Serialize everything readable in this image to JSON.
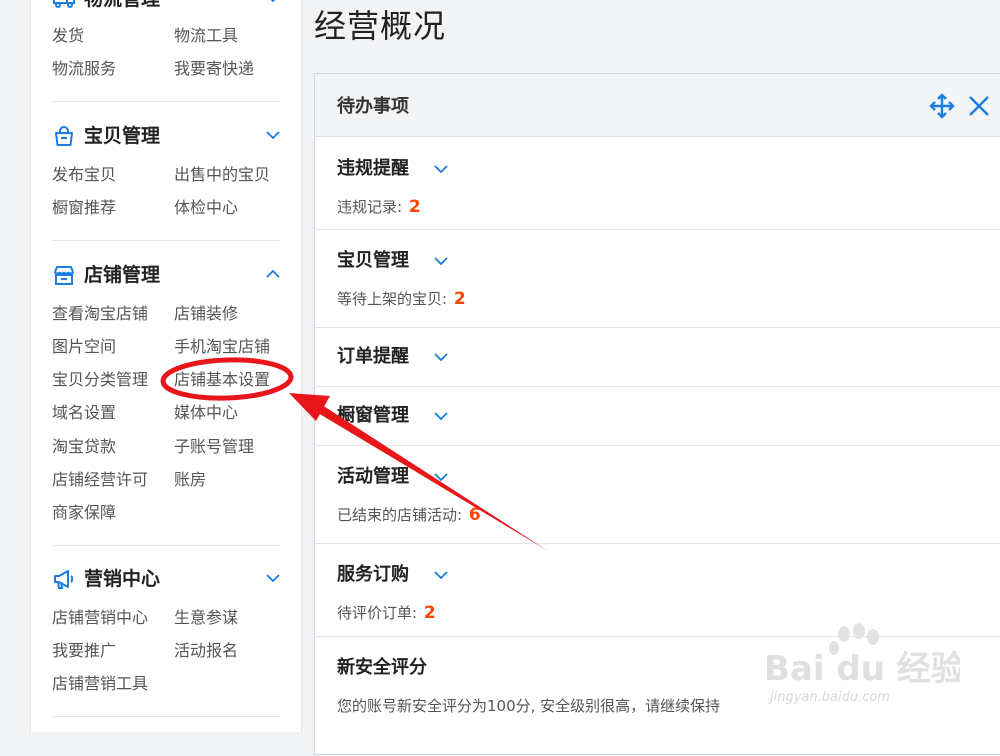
{
  "sidebar": {
    "logistics": {
      "title": "物流管理",
      "links": [
        "发货",
        "物流工具",
        "物流服务",
        "我要寄快递"
      ]
    },
    "items": {
      "title": "宝贝管理",
      "links": [
        "发布宝贝",
        "出售中的宝贝",
        "橱窗推荐",
        "体检中心"
      ]
    },
    "shop": {
      "title": "店铺管理",
      "links": [
        "查看淘宝店铺",
        "店铺装修",
        "图片空间",
        "手机淘宝店铺",
        "宝贝分类管理",
        "店铺基本设置",
        "域名设置",
        "媒体中心",
        "淘宝贷款",
        "子账号管理",
        "店铺经营许可",
        "账房",
        "商家保障"
      ]
    },
    "marketing": {
      "title": "营销中心",
      "links": [
        "店铺营销中心",
        "生意参谋",
        "我要推广",
        "活动报名",
        "店铺营销工具"
      ]
    }
  },
  "main": {
    "page_title": "经营概况",
    "panel": {
      "title": "待办事项",
      "rows": [
        {
          "title": "违规提醒",
          "text": "违规记录:",
          "count": "2"
        },
        {
          "title": "宝贝管理",
          "text": "等待上架的宝贝:",
          "count": "2"
        },
        {
          "title": "订单提醒"
        },
        {
          "title": "橱窗管理"
        },
        {
          "title": "活动管理",
          "text": "已结束的店铺活动:",
          "count": "6"
        },
        {
          "title": "服务订购",
          "text": "待评价订单:",
          "count": "2"
        },
        {
          "title": "新安全评分",
          "text": "您的账号新安全评分为100分, 安全级别很高，请继续保持"
        }
      ]
    }
  },
  "colors": {
    "accent": "#1a7ee0",
    "count": "#ff4400",
    "annotation": "#e8161a"
  },
  "watermark": {
    "brand": "Bai du 经验",
    "url": "jingyan.baidu.com"
  }
}
